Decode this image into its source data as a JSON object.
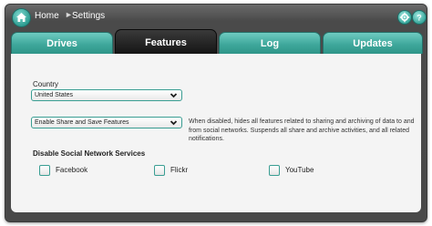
{
  "breadcrumb": {
    "home": "Home",
    "current": "Settings"
  },
  "tabs": [
    {
      "label": "Drives",
      "active": false
    },
    {
      "label": "Features",
      "active": true
    },
    {
      "label": "Log",
      "active": false
    },
    {
      "label": "Updates",
      "active": false
    }
  ],
  "country": {
    "label": "Country",
    "value": "United States"
  },
  "share": {
    "value": "Enable Share and Save Features",
    "help": "When disabled, hides all features related to sharing and archiving of data to and from social networks. Suspends all share and archive activities, and all related notifications."
  },
  "social": {
    "title": "Disable Social Network Services",
    "options": [
      {
        "label": "Facebook",
        "checked": false
      },
      {
        "label": "Flickr",
        "checked": false
      },
      {
        "label": "YouTube",
        "checked": false
      }
    ]
  },
  "colors": {
    "accent": "#3fa89c",
    "frame": "#4a4a4a",
    "active_tab": "#151515",
    "panel": "#f4f4f4"
  },
  "icons": {
    "home": "home-icon",
    "settings": "gear-icon",
    "dropdown": "chevron-down-icon"
  }
}
